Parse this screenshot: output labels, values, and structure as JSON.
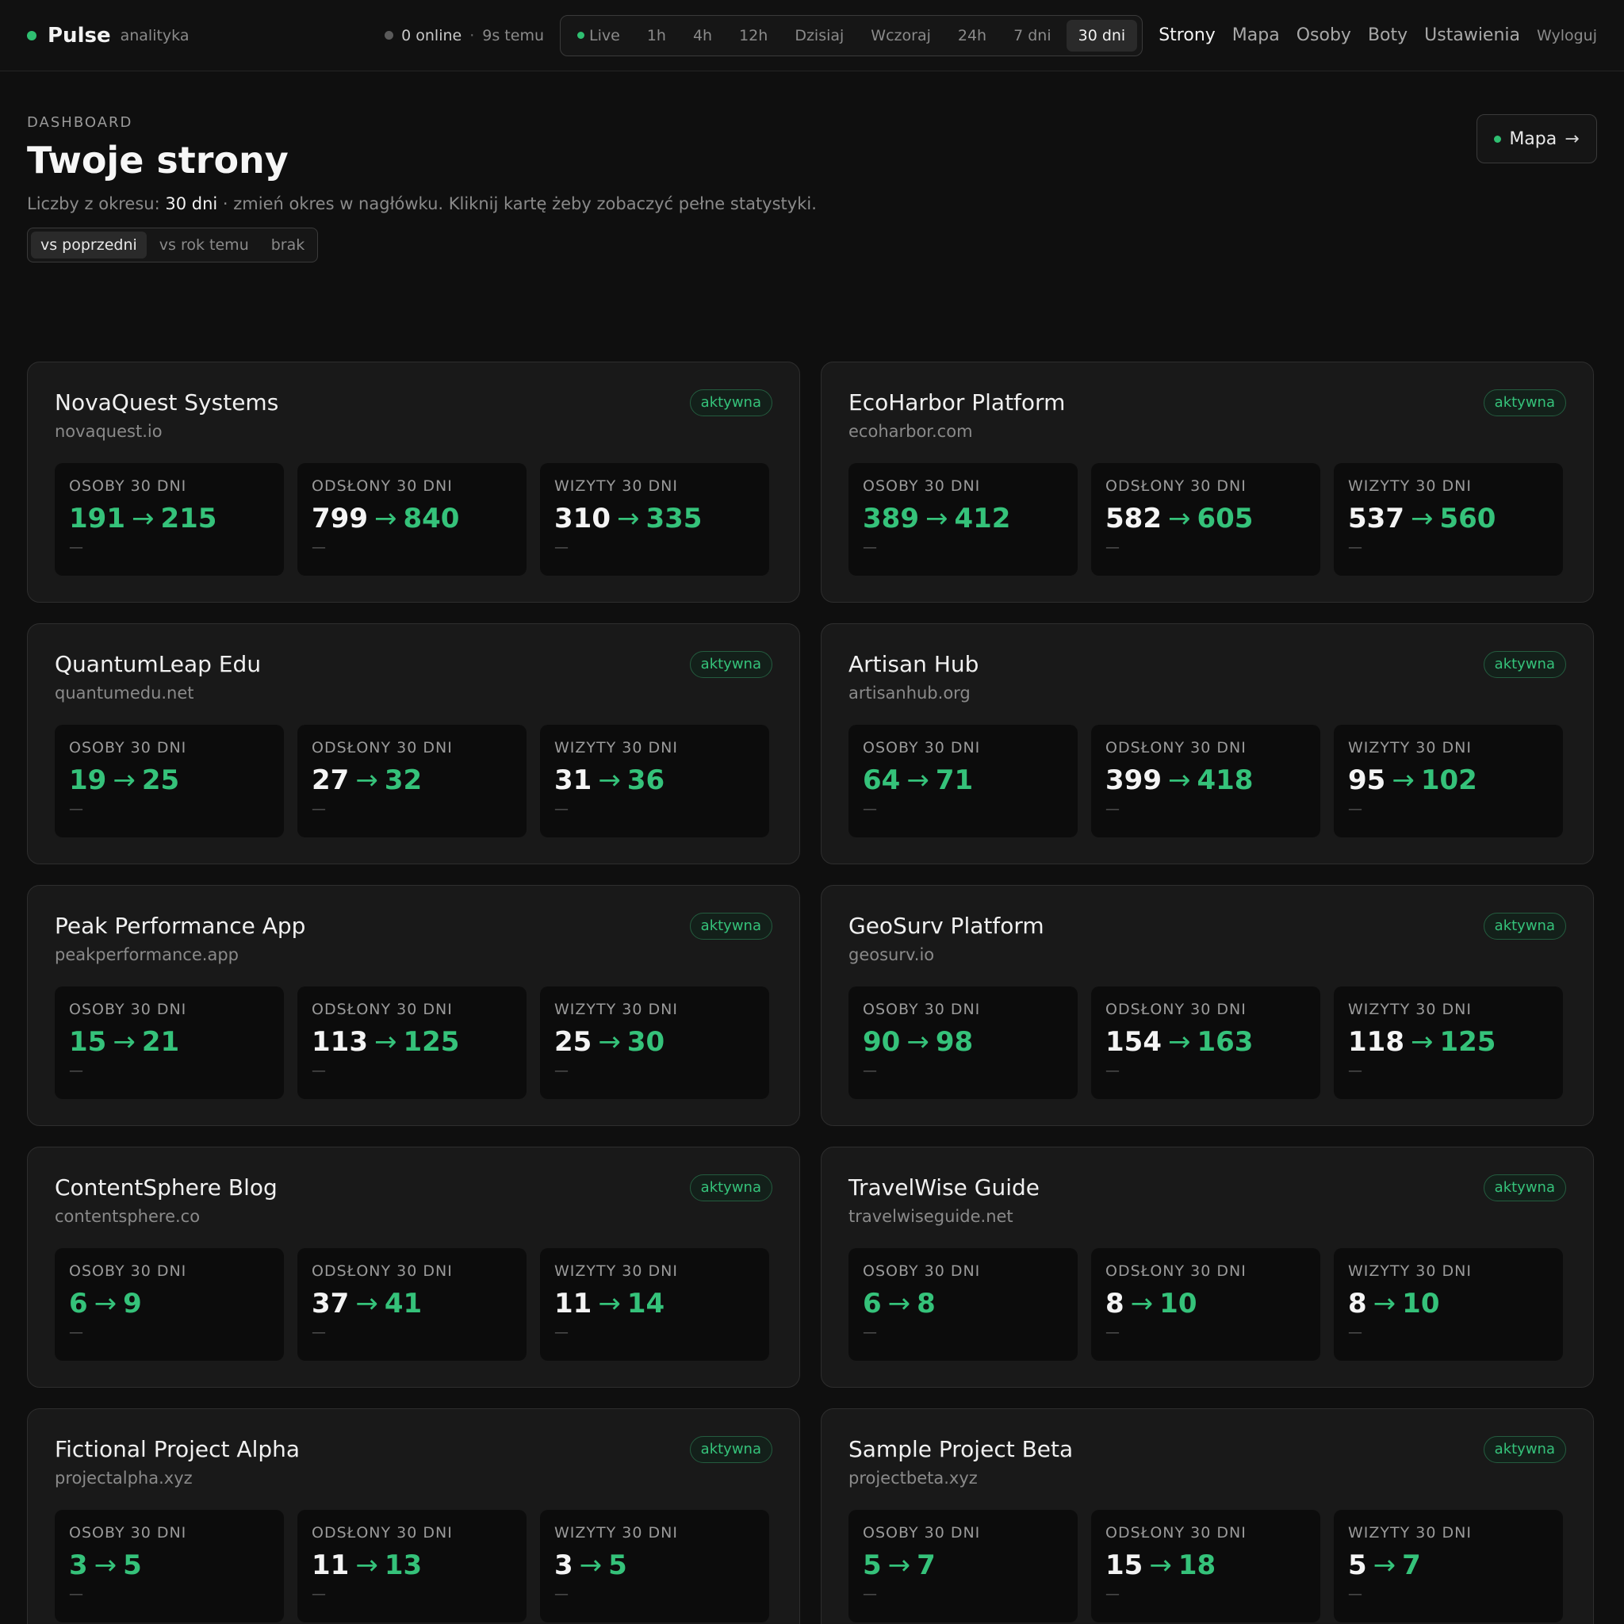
{
  "brand": {
    "name": "Pulse",
    "subtitle": "analityka"
  },
  "status": {
    "online": "0 online",
    "separator": "·",
    "ago": "9s temu"
  },
  "ranges": [
    "Live",
    "1h",
    "4h",
    "12h",
    "Dzisiaj",
    "Wczoraj",
    "24h",
    "7 dni",
    "30 dni"
  ],
  "active_range": "30 dni",
  "nav": {
    "items": [
      "Strony",
      "Mapa",
      "Osoby",
      "Boty",
      "Ustawienia"
    ],
    "active": "Strony",
    "logout": "Wyloguj"
  },
  "header": {
    "eyebrow": "DASHBOARD",
    "title": "Twoje strony",
    "period_prefix": "Liczby z okresu:",
    "period_value": "30 dni",
    "period_suffix": "· zmień okres w nagłówku. Kliknij kartę żeby zobaczyć pełne statystyki.",
    "compare_options": [
      "vs poprzedni",
      "vs rok temu",
      "brak"
    ],
    "compare_active": "vs poprzedni",
    "map_button": "Mapa"
  },
  "arrow": "→",
  "metric_labels": [
    "OSOBY 30 DNI",
    "ODSŁONY 30 DNI",
    "WIZYTY 30 DNI"
  ],
  "badge_label": "aktywna",
  "delta_placeholder": "—",
  "colors": {
    "accent": "#35c27a",
    "background": "#0f0f0f",
    "card": "#191919",
    "tile": "#0c0c0c"
  },
  "sites": [
    {
      "name": "NovaQuest Systems",
      "domain": "novaquest.io",
      "metrics": [
        {
          "prev": "191",
          "cur": "215"
        },
        {
          "prev": "799",
          "cur": "840"
        },
        {
          "prev": "310",
          "cur": "335"
        }
      ]
    },
    {
      "name": "EcoHarbor Platform",
      "domain": "ecoharbor.com",
      "metrics": [
        {
          "prev": "389",
          "cur": "412"
        },
        {
          "prev": "582",
          "cur": "605"
        },
        {
          "prev": "537",
          "cur": "560"
        }
      ]
    },
    {
      "name": "QuantumLeap Edu",
      "domain": "quantumedu.net",
      "metrics": [
        {
          "prev": "19",
          "cur": "25"
        },
        {
          "prev": "27",
          "cur": "32"
        },
        {
          "prev": "31",
          "cur": "36"
        }
      ]
    },
    {
      "name": "Artisan Hub",
      "domain": "artisanhub.org",
      "metrics": [
        {
          "prev": "64",
          "cur": "71"
        },
        {
          "prev": "399",
          "cur": "418"
        },
        {
          "prev": "95",
          "cur": "102"
        }
      ]
    },
    {
      "name": "Peak Performance App",
      "domain": "peakperformance.app",
      "metrics": [
        {
          "prev": "15",
          "cur": "21"
        },
        {
          "prev": "113",
          "cur": "125"
        },
        {
          "prev": "25",
          "cur": "30"
        }
      ]
    },
    {
      "name": "GeoSurv Platform",
      "domain": "geosurv.io",
      "metrics": [
        {
          "prev": "90",
          "cur": "98"
        },
        {
          "prev": "154",
          "cur": "163"
        },
        {
          "prev": "118",
          "cur": "125"
        }
      ]
    },
    {
      "name": "ContentSphere Blog",
      "domain": "contentsphere.co",
      "metrics": [
        {
          "prev": "6",
          "cur": "9"
        },
        {
          "prev": "37",
          "cur": "41"
        },
        {
          "prev": "11",
          "cur": "14"
        }
      ]
    },
    {
      "name": "TravelWise Guide",
      "domain": "travelwiseguide.net",
      "metrics": [
        {
          "prev": "6",
          "cur": "8"
        },
        {
          "prev": "8",
          "cur": "10"
        },
        {
          "prev": "8",
          "cur": "10"
        }
      ]
    },
    {
      "name": "Fictional Project Alpha",
      "domain": "projectalpha.xyz",
      "metrics": [
        {
          "prev": "3",
          "cur": "5"
        },
        {
          "prev": "11",
          "cur": "13"
        },
        {
          "prev": "3",
          "cur": "5"
        }
      ]
    },
    {
      "name": "Sample Project Beta",
      "domain": "projectbeta.xyz",
      "metrics": [
        {
          "prev": "5",
          "cur": "7"
        },
        {
          "prev": "15",
          "cur": "18"
        },
        {
          "prev": "5",
          "cur": "7"
        }
      ]
    }
  ]
}
